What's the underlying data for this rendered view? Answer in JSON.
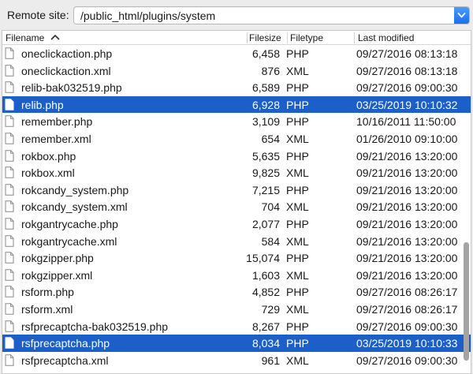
{
  "remote_site": {
    "label": "Remote site:",
    "path": "/public_html/plugins/system"
  },
  "columns": {
    "filename": "Filename",
    "filesize": "Filesize",
    "filetype": "Filetype",
    "last_modified": "Last modified"
  },
  "sort": {
    "column": "filename",
    "direction": "ascending",
    "icon": "chevron-up-icon"
  },
  "colors": {
    "selection": "#1c5fc9",
    "selection_text": "#ffffff",
    "accent": "#1a6ff0"
  },
  "files": [
    {
      "name": "oneclickaction.php",
      "size": "6,458",
      "type": "PHP",
      "modified": "09/27/2016 08:13:18",
      "selected": false
    },
    {
      "name": "oneclickaction.xml",
      "size": "876",
      "type": "XML",
      "modified": "09/27/2016 08:13:18",
      "selected": false
    },
    {
      "name": "relib-bak032519.php",
      "size": "6,589",
      "type": "PHP",
      "modified": "09/27/2016 09:00:30",
      "selected": false
    },
    {
      "name": "relib.php",
      "size": "6,928",
      "type": "PHP",
      "modified": "03/25/2019 10:10:32",
      "selected": true
    },
    {
      "name": "remember.php",
      "size": "3,109",
      "type": "PHP",
      "modified": "10/16/2011 11:50:00",
      "selected": false
    },
    {
      "name": "remember.xml",
      "size": "654",
      "type": "XML",
      "modified": "01/26/2010 09:10:00",
      "selected": false
    },
    {
      "name": "rokbox.php",
      "size": "5,635",
      "type": "PHP",
      "modified": "09/21/2016 13:20:00",
      "selected": false
    },
    {
      "name": "rokbox.xml",
      "size": "9,825",
      "type": "XML",
      "modified": "09/21/2016 13:20:00",
      "selected": false
    },
    {
      "name": "rokcandy_system.php",
      "size": "7,215",
      "type": "PHP",
      "modified": "09/21/2016 13:20:00",
      "selected": false
    },
    {
      "name": "rokcandy_system.xml",
      "size": "704",
      "type": "XML",
      "modified": "09/21/2016 13:20:00",
      "selected": false
    },
    {
      "name": "rokgantrycache.php",
      "size": "2,077",
      "type": "PHP",
      "modified": "09/21/2016 13:20:00",
      "selected": false
    },
    {
      "name": "rokgantrycache.xml",
      "size": "584",
      "type": "XML",
      "modified": "09/21/2016 13:20:00",
      "selected": false
    },
    {
      "name": "rokgzipper.php",
      "size": "15,074",
      "type": "PHP",
      "modified": "09/21/2016 13:20:00",
      "selected": false
    },
    {
      "name": "rokgzipper.xml",
      "size": "1,603",
      "type": "XML",
      "modified": "09/21/2016 13:20:00",
      "selected": false
    },
    {
      "name": "rsform.php",
      "size": "4,852",
      "type": "PHP",
      "modified": "09/27/2016 08:26:17",
      "selected": false
    },
    {
      "name": "rsform.xml",
      "size": "729",
      "type": "XML",
      "modified": "09/27/2016 08:26:17",
      "selected": false
    },
    {
      "name": "rsfprecaptcha-bak032519.php",
      "size": "8,267",
      "type": "PHP",
      "modified": "09/27/2016 09:00:30",
      "selected": false
    },
    {
      "name": "rsfprecaptcha.php",
      "size": "8,034",
      "type": "PHP",
      "modified": "03/25/2019 10:10:33",
      "selected": true
    },
    {
      "name": "rsfprecaptcha.xml",
      "size": "961",
      "type": "XML",
      "modified": "09/27/2016 09:00:30",
      "selected": false
    }
  ]
}
